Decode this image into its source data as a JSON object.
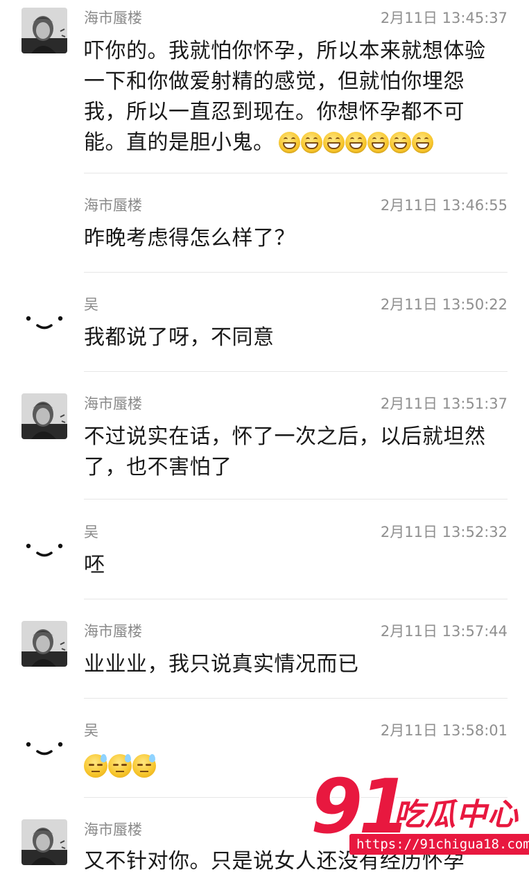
{
  "messages": [
    {
      "sender": "海市蜃楼",
      "time": "2月11日 13:45:37",
      "avatar": "photo",
      "text": "吓你的。我就怕你怀孕，所以本来就想体验一下和你做爱射精的感觉，但就怕你埋怨我，所以一直忍到现在。你想怀孕都不可能。直的是胆小鬼。",
      "emoji": "grin",
      "emoji_count": 7
    },
    {
      "sender": "海市蜃楼",
      "time": "2月11日 13:46:55",
      "avatar": "none",
      "text": "昨晚考虑得怎么样了？"
    },
    {
      "sender": "吴",
      "time": "2月11日 13:50:22",
      "avatar": "smiley",
      "text": "我都说了呀，不同意"
    },
    {
      "sender": "海市蜃楼",
      "time": "2月11日 13:51:37",
      "avatar": "photo",
      "text": "不过说实在话，怀了一次之后，以后就坦然了，也不害怕了"
    },
    {
      "sender": "吴",
      "time": "2月11日 13:52:32",
      "avatar": "smiley",
      "text": "呸"
    },
    {
      "sender": "海市蜃楼",
      "time": "2月11日 13:57:44",
      "avatar": "photo",
      "text": "业业业，我只说真实情况而已"
    },
    {
      "sender": "吴",
      "time": "2月11日 13:58:01",
      "avatar": "smiley",
      "text": "",
      "emoji": "sweat",
      "emoji_count": 3
    },
    {
      "sender": "海市蜃楼",
      "time": "",
      "avatar": "photo",
      "text": "又不针对你。只是说女人还没有经历怀孕"
    }
  ],
  "watermark": {
    "number": "91",
    "title": "吃瓜中心",
    "url": "https://91chigua18.com"
  },
  "colors": {
    "accent": "#e8183f",
    "meta_text": "#8f8f8f",
    "divider": "#e6e6e6"
  }
}
